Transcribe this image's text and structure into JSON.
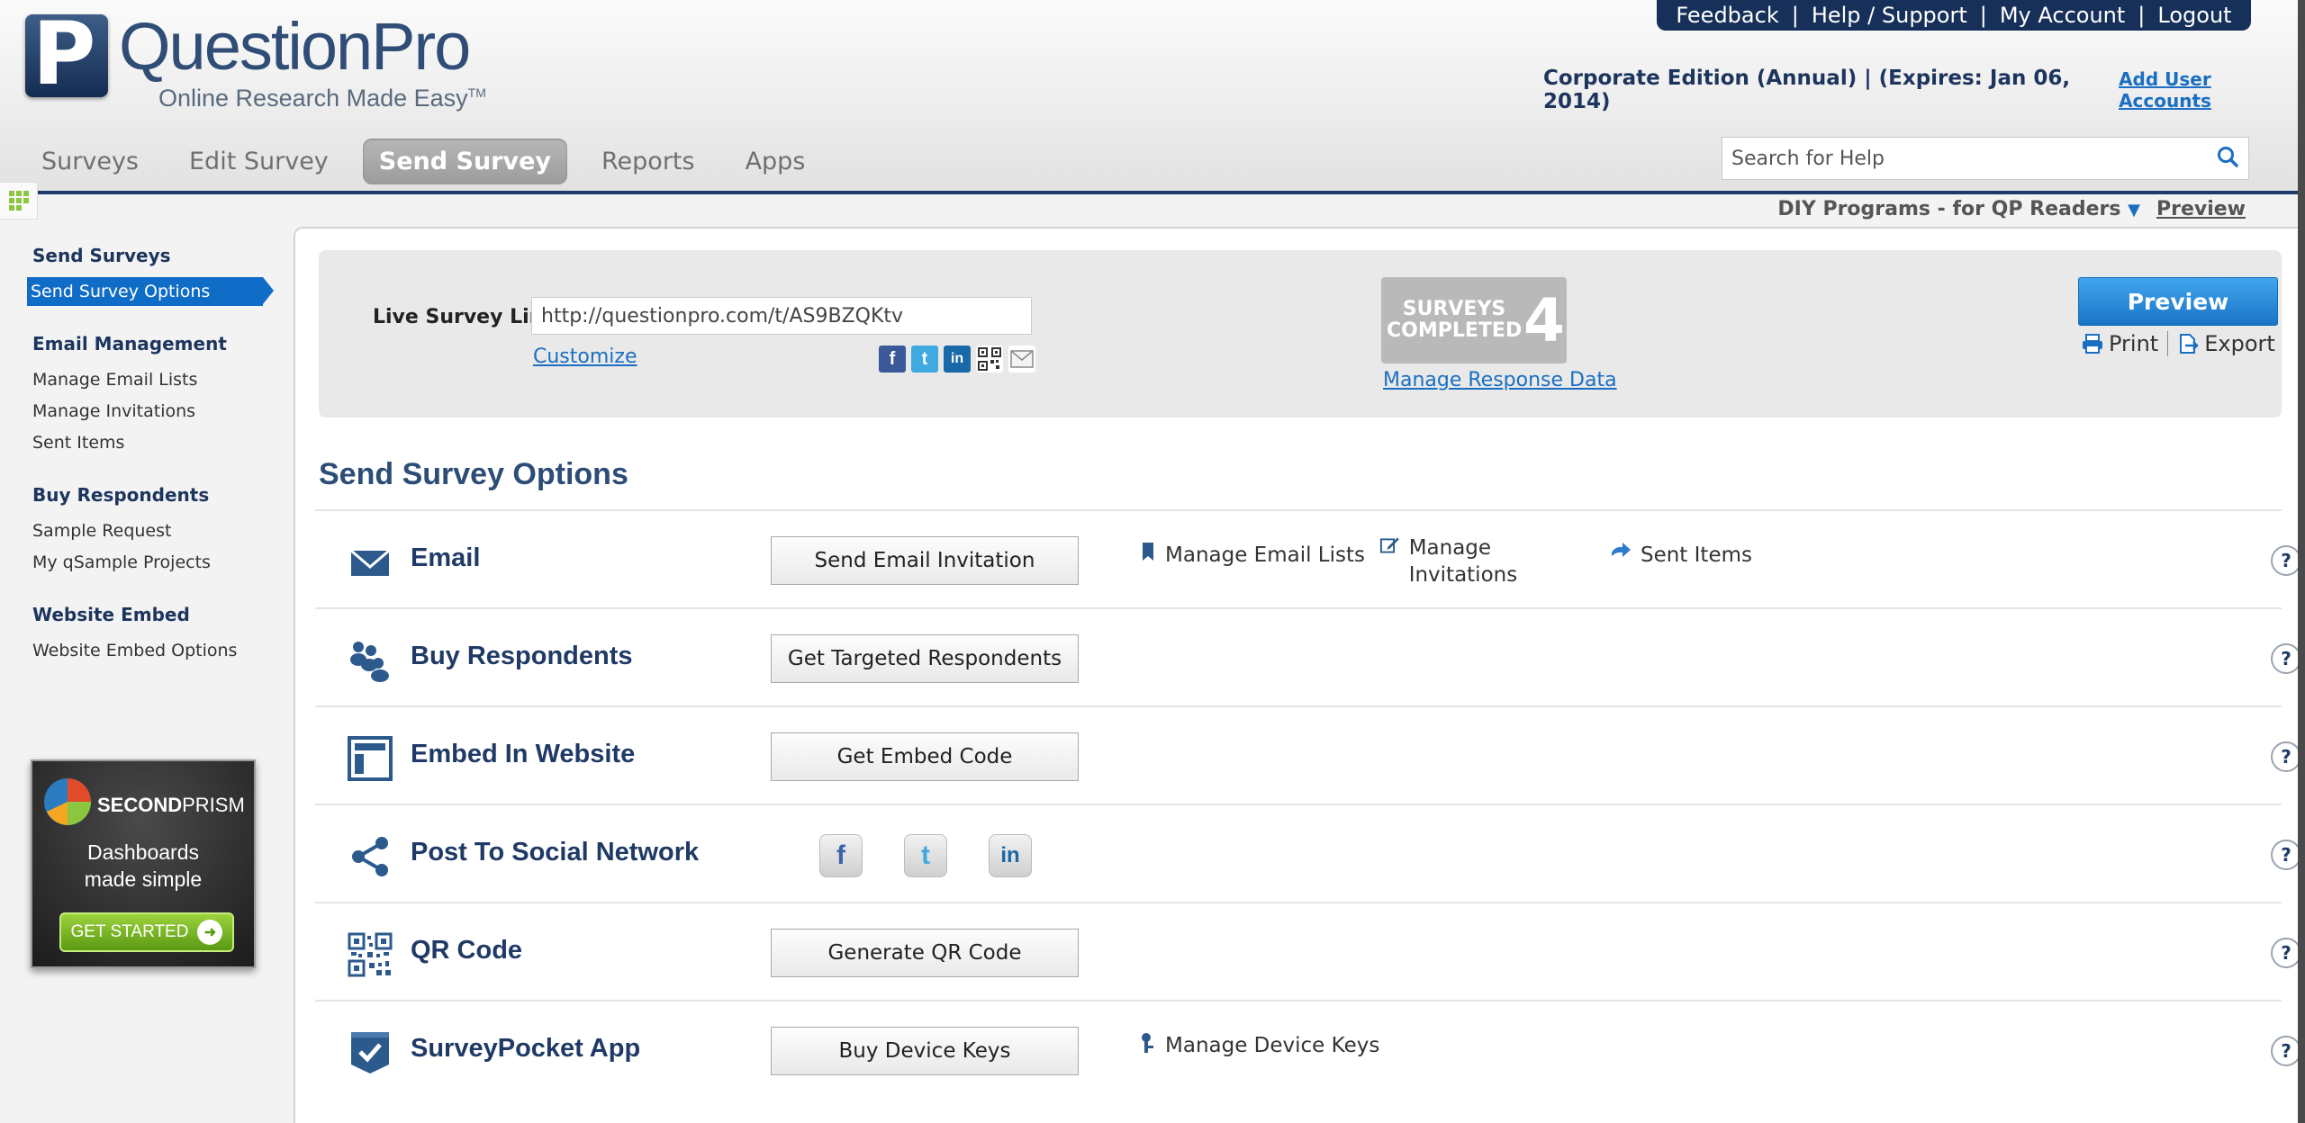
{
  "brand": {
    "logo_letter": "P",
    "name": "QuestionPro",
    "tagline": "Online Research Made Easy",
    "tagline_tm": "TM"
  },
  "topbar": {
    "feedback": "Feedback",
    "help": "Help / Support",
    "account": "My Account",
    "logout": "Logout",
    "sep": "|"
  },
  "edition": {
    "text": "Corporate Edition (Annual) | (Expires: Jan 06, 2014)",
    "add_users": "Add User Accounts"
  },
  "nav": {
    "tabs": [
      "Surveys",
      "Edit Survey",
      "Send Survey",
      "Reports",
      "Apps"
    ],
    "active": "Send Survey"
  },
  "help_search": {
    "placeholder": "Search for Help"
  },
  "subbar": {
    "program": "DIY Programs - for QP Readers",
    "preview": "Preview"
  },
  "sidebar": {
    "sections": [
      {
        "title": "Send Surveys",
        "items": [
          "Send Survey Options"
        ]
      },
      {
        "title": "Email Management",
        "items": [
          "Manage Email Lists",
          "Manage Invitations",
          "Sent Items"
        ]
      },
      {
        "title": "Buy Respondents",
        "items": [
          "Sample Request",
          "My qSample Projects"
        ]
      },
      {
        "title": "Website Embed",
        "items": [
          "Website Embed Options"
        ]
      }
    ],
    "active_item": "Send Survey Options"
  },
  "ad": {
    "brand_bold": "SECOND",
    "brand_rest": "PRISM",
    "line1": "Dashboards",
    "line2": "made simple",
    "cta": "GET STARTED"
  },
  "live": {
    "label": "Live Survey Link",
    "url": "http://questionpro.com/t/AS9BZQKtv",
    "customize": "Customize",
    "completed_line1": "SURVEYS",
    "completed_line2": "COMPLETED",
    "completed_count": "4",
    "manage_response": "Manage Response Data",
    "preview": "Preview",
    "print": "Print",
    "export": "Export",
    "share": {
      "facebook": "f",
      "twitter": "t",
      "linkedin": "in"
    }
  },
  "options": {
    "title": "Send Survey Options",
    "rows": [
      {
        "label": "Email",
        "button": "Send Email Invitation",
        "links": [
          "Manage Email Lists",
          "Manage Invitations",
          "Sent Items"
        ]
      },
      {
        "label": "Buy Respondents",
        "button": "Get Targeted Respondents"
      },
      {
        "label": "Embed In Website",
        "button": "Get Embed Code"
      },
      {
        "label": "Post To Social Network",
        "social": [
          "f",
          "t",
          "in"
        ]
      },
      {
        "label": "QR Code",
        "button": "Generate QR Code"
      },
      {
        "label": "SurveyPocket App",
        "button": "Buy Device Keys",
        "links": [
          "Manage Device Keys"
        ]
      }
    ],
    "help_glyph": "?"
  },
  "colors": {
    "navy": "#1f3a66",
    "link": "#1a6fc2",
    "active_blue": "#0f6cc7",
    "preview_blue": "#2a8ad8"
  }
}
